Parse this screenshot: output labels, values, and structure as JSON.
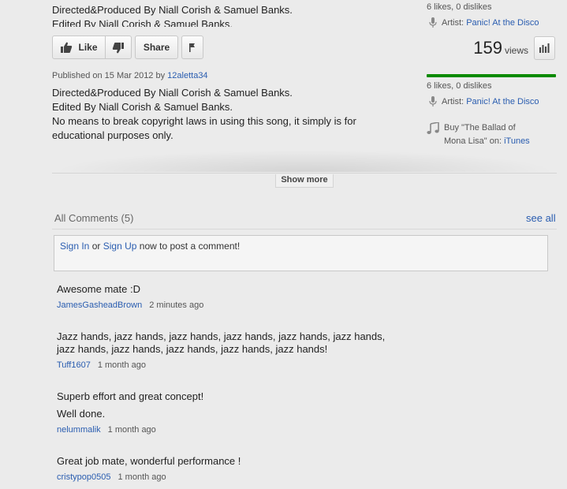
{
  "description_top_cut": "Directed&Produced By Niall Corish & Samuel Banks.\nEdited By Niall Corish & Samuel Banks.",
  "actions": {
    "like_label": "Like",
    "share_label": "Share"
  },
  "published": {
    "prefix": "Published on 15 Mar 2012 by",
    "user": "12aletta34"
  },
  "description_lines": [
    "Directed&Produced By Niall Corish & Samuel Banks.",
    "Edited By Niall Corish & Samuel Banks.",
    "No means to break copyright laws in using this song, it simply is for",
    "educational purposes only."
  ],
  "sidebar": {
    "likes_top": "6 likes, 0 dislikes",
    "artist_label": "Artist:",
    "artist_name": "Panic! At the Disco",
    "views_count": "159",
    "views_label": "views",
    "likes": "6 likes, 0 dislikes",
    "like_ratio": 1.0,
    "buy_text_line1": "Buy \"The Ballad of",
    "buy_text_line2": "Mona Lisa\" on:",
    "buy_store": "iTunes"
  },
  "show_more_label": "Show more",
  "comments": {
    "title": "All Comments (5)",
    "see_all": "see all",
    "sign_in": "Sign In",
    "or_text": "or",
    "sign_up": "Sign Up",
    "post_text": "now to post a comment!",
    "items": [
      {
        "lines": [
          "Awesome mate :D"
        ],
        "author": "JamesGasheadBrown",
        "time": "2 minutes ago"
      },
      {
        "lines": [
          "Jazz hands, jazz hands, jazz hands, jazz hands, jazz hands, jazz hands,",
          "jazz hands, jazz hands, jazz hands, jazz hands, jazz hands!"
        ],
        "author": "Tuff1607",
        "time": "1 month ago"
      },
      {
        "lines": [
          "Superb effort and great concept!",
          "Well done."
        ],
        "author": "nelummalik",
        "time": "1 month ago"
      },
      {
        "lines": [
          "Great job mate, wonderful performance !"
        ],
        "author": "cristypop0505",
        "time": "1 month ago"
      }
    ]
  }
}
